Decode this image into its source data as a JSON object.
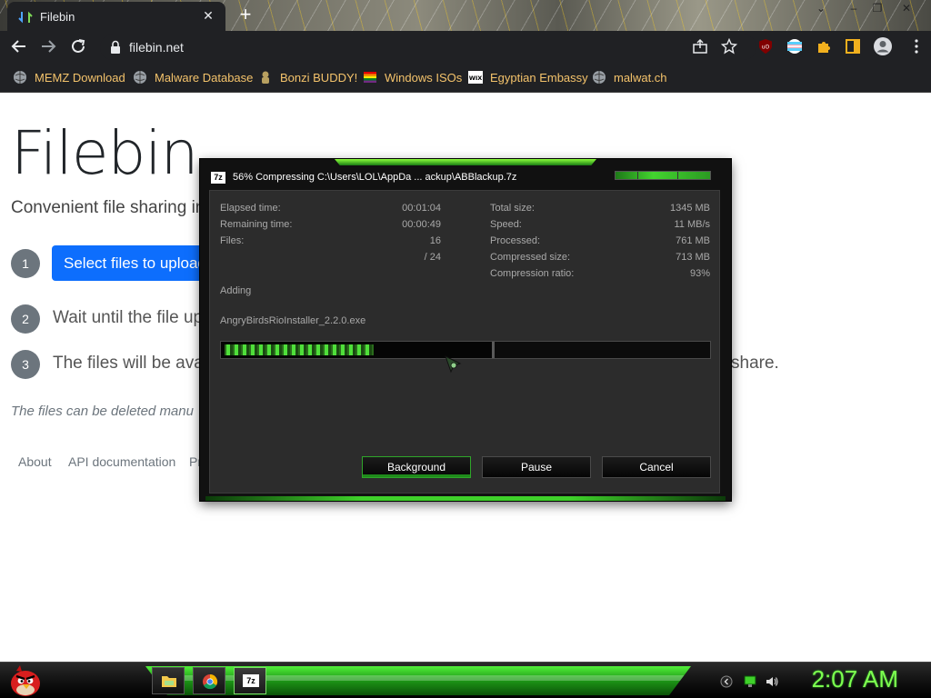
{
  "browser": {
    "tab_title": "Filebin",
    "tab_close_glyph": "✕",
    "new_tab_glyph": "+",
    "url": "filebin.net",
    "window_controls": [
      "‒",
      "❐",
      "✕"
    ]
  },
  "bookmarks": [
    {
      "label": "MEMZ Download",
      "icon": "globe-icon"
    },
    {
      "label": "Malware Database",
      "icon": "globe-icon"
    },
    {
      "label": "Bonzi BUDDY!",
      "icon": "bonzi-icon"
    },
    {
      "label": "Windows ISOs",
      "icon": "windows-flag-icon"
    },
    {
      "label": "Egyptian Embassy",
      "icon": "wix-icon"
    },
    {
      "label": "malwat.ch",
      "icon": "globe-icon"
    }
  ],
  "page": {
    "title": "Filebin",
    "subtitle": "Convenient file sharing in",
    "steps": [
      {
        "num": "1",
        "button": "Select files to upload"
      },
      {
        "num": "2",
        "text": "Wait until the file up"
      },
      {
        "num": "3",
        "text": "The files will be ava",
        "tail": "share."
      }
    ],
    "note": "The files can be deleted manu",
    "footer_links": [
      "About",
      "API documentation",
      "Pr"
    ]
  },
  "dialog": {
    "app_icon_text": "7z",
    "title": "56% Compressing C:\\Users\\LOL\\AppDa ... ackup\\ABBlackup.7z",
    "left": [
      {
        "label": "Elapsed time:",
        "value": "00:01:04"
      },
      {
        "label": "Remaining time:",
        "value": "00:00:49"
      },
      {
        "label": "Files:",
        "value": "16"
      },
      {
        "label": "",
        "value": "/ 24"
      }
    ],
    "right": [
      {
        "label": "Total size:",
        "value": "1345 MB"
      },
      {
        "label": "Speed:",
        "value": "11 MB/s"
      },
      {
        "label": "Processed:",
        "value": "761 MB"
      },
      {
        "label": "Compressed size:",
        "value": "713 MB"
      },
      {
        "label": "Compression ratio:",
        "value": "93%"
      }
    ],
    "status": "Adding",
    "current_file": "AngryBirdsRioInstaller_2.2.0.exe",
    "progress": 0.56,
    "buttons": {
      "background": "Background",
      "pause": "Pause",
      "cancel": "Cancel"
    }
  },
  "taskbar": {
    "clock": "2:07 AM",
    "items": [
      "explorer-icon",
      "chrome-icon",
      "7zip-icon"
    ]
  },
  "colors": {
    "accent_blue": "#0d6efd",
    "neon_green": "#43d42f",
    "bookmark_text": "#f4c36b"
  }
}
